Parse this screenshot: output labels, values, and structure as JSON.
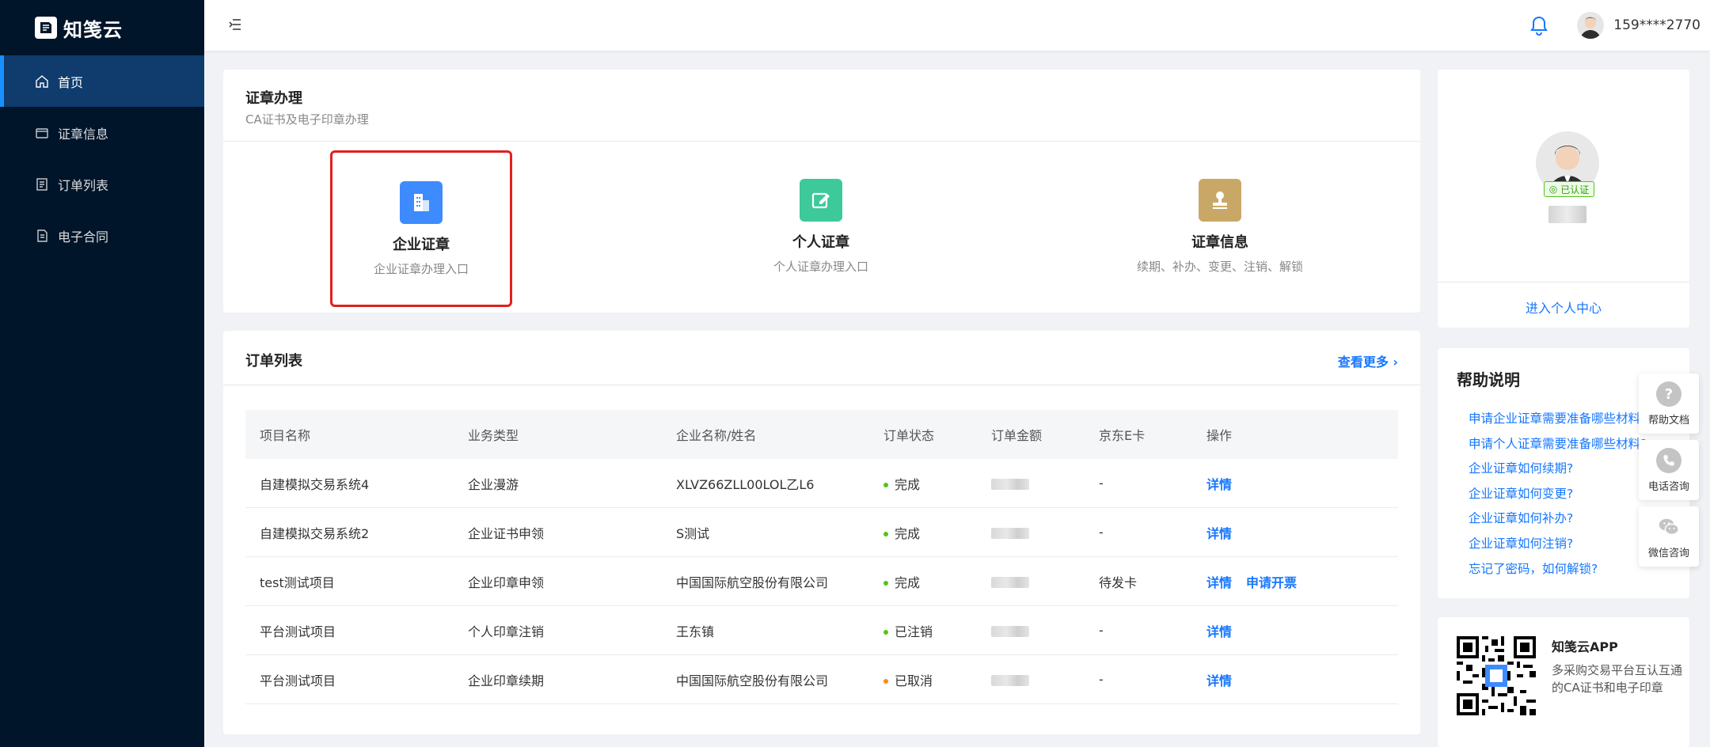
{
  "app": {
    "logo_text": "知笺云"
  },
  "sidebar": {
    "items": [
      {
        "label": "首页",
        "icon": "home-icon"
      },
      {
        "label": "证章信息",
        "icon": "card-icon"
      },
      {
        "label": "订单列表",
        "icon": "list-icon"
      },
      {
        "label": "电子合同",
        "icon": "contract-icon"
      }
    ]
  },
  "header": {
    "user_phone": "159****2770"
  },
  "cert_section": {
    "title": "证章办理",
    "subtitle": "CA证书及电子印章办理",
    "options": [
      {
        "name": "企业证章",
        "desc": "企业证章办理入口",
        "color": "#3d8bff"
      },
      {
        "name": "个人证章",
        "desc": "个人证章办理入口",
        "color": "#3ec99a"
      },
      {
        "name": "证章信息",
        "desc": "续期、补办、变更、注销、解锁",
        "color": "#c9a867"
      }
    ]
  },
  "orders": {
    "title": "订单列表",
    "more": "查看更多",
    "columns": [
      "项目名称",
      "业务类型",
      "企业名称/姓名",
      "订单状态",
      "订单金额",
      "京东E卡",
      "操作"
    ],
    "rows": [
      {
        "project": "自建模拟交易系统4",
        "type": "企业漫游",
        "name": "XLVZ66ZLL00LOL乙L6",
        "status": "完成",
        "status_color": "#52c41a",
        "ecard": "-",
        "actions": [
          "详情"
        ]
      },
      {
        "project": "自建模拟交易系统2",
        "type": "企业证书申领",
        "name": "S测试",
        "status": "完成",
        "status_color": "#52c41a",
        "ecard": "-",
        "actions": [
          "详情"
        ]
      },
      {
        "project": "test测试项目",
        "type": "企业印章申领",
        "name": "中国国际航空股份有限公司",
        "status": "完成",
        "status_color": "#52c41a",
        "ecard": "待发卡",
        "actions": [
          "详情",
          "申请开票"
        ]
      },
      {
        "project": "平台测试项目",
        "type": "个人印章注销",
        "name": "王东镇",
        "status": "已注销",
        "status_color": "#52c41a",
        "ecard": "-",
        "actions": [
          "详情"
        ]
      },
      {
        "project": "平台测试项目",
        "type": "企业印章续期",
        "name": "中国国际航空股份有限公司",
        "status": "已取消",
        "status_color": "#fa8c16",
        "ecard": "-",
        "actions": [
          "详情"
        ]
      }
    ]
  },
  "profile": {
    "verified": "已认证",
    "center_link": "进入个人中心"
  },
  "help": {
    "title": "帮助说明",
    "items": [
      "申请企业证章需要准备哪些材料?",
      "申请个人证章需要准备哪些材料?",
      "企业证章如何续期?",
      "企业证章如何变更?",
      "企业证章如何补办?",
      "企业证章如何注销?",
      "忘记了密码，如何解锁?"
    ]
  },
  "app_promo": {
    "name": "知笺云APP",
    "desc": "多采购交易平台互认互通的CA证书和电子印章"
  },
  "float_buttons": [
    {
      "label": "帮助文档",
      "icon": "question-icon"
    },
    {
      "label": "电话咨询",
      "icon": "phone-icon"
    },
    {
      "label": "微信咨询",
      "icon": "wechat-icon"
    }
  ]
}
